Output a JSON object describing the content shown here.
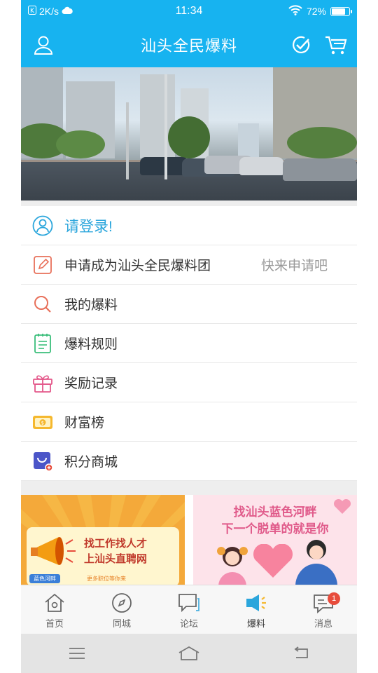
{
  "status": {
    "speed": "2K/s",
    "time": "11:34",
    "battery": "72%",
    "battery_level": 0.72
  },
  "header": {
    "title": "汕头全民爆料",
    "user_icon": "user-icon",
    "check_icon": "checkmark-circle-icon",
    "cart_icon": "shopping-cart-icon"
  },
  "menu": {
    "login": "请登录!",
    "apply": "申请成为汕头全民爆料团",
    "apply_hint": "快来申请吧",
    "my_reports": "我的爆料",
    "rules": "爆料规则",
    "rewards": "奖励记录",
    "wealth": "财富榜",
    "points_mall": "积分商城"
  },
  "ads": {
    "ad1_line1": "找工作找人才",
    "ad1_line2": "上汕头直聘网",
    "ad1_pill": "蓝色河畔",
    "ad1_small": "更多职位等你来",
    "ad2_line1": "找汕头蓝色河畔",
    "ad2_line2": "下一个脱单的就是你"
  },
  "nav": {
    "home": "首页",
    "local": "同城",
    "forum": "论坛",
    "report": "爆料",
    "messages": "消息",
    "messages_badge": "1"
  },
  "colors": {
    "primary": "#17b3f0",
    "accent_text": "#2ba6dc",
    "badge": "#e74c3c"
  }
}
